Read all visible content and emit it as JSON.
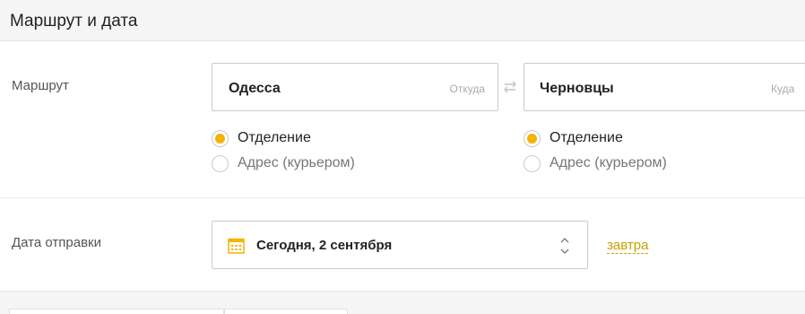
{
  "section": {
    "title": "Маршрут и дата"
  },
  "route": {
    "label": "Маршрут",
    "from": {
      "city": "Одесса",
      "hint": "Откуда",
      "options": [
        {
          "label": "Отделение",
          "checked": true
        },
        {
          "label": "Адрес (курьером)",
          "checked": false
        }
      ]
    },
    "to": {
      "city": "Черновцы",
      "hint": "Куда",
      "options": [
        {
          "label": "Отделение",
          "checked": true
        },
        {
          "label": "Адрес (курьером)",
          "checked": false
        }
      ]
    }
  },
  "date": {
    "label": "Дата отправки",
    "value": "Сегодня, 2 сентября",
    "tomorrow_link": "завтра"
  },
  "colors": {
    "accent": "#f4b400",
    "link": "#c8a000"
  },
  "icons": {
    "swap": "swap-arrows-icon",
    "calendar": "calendar-icon",
    "stepper": "chevron-up-down-icon"
  }
}
